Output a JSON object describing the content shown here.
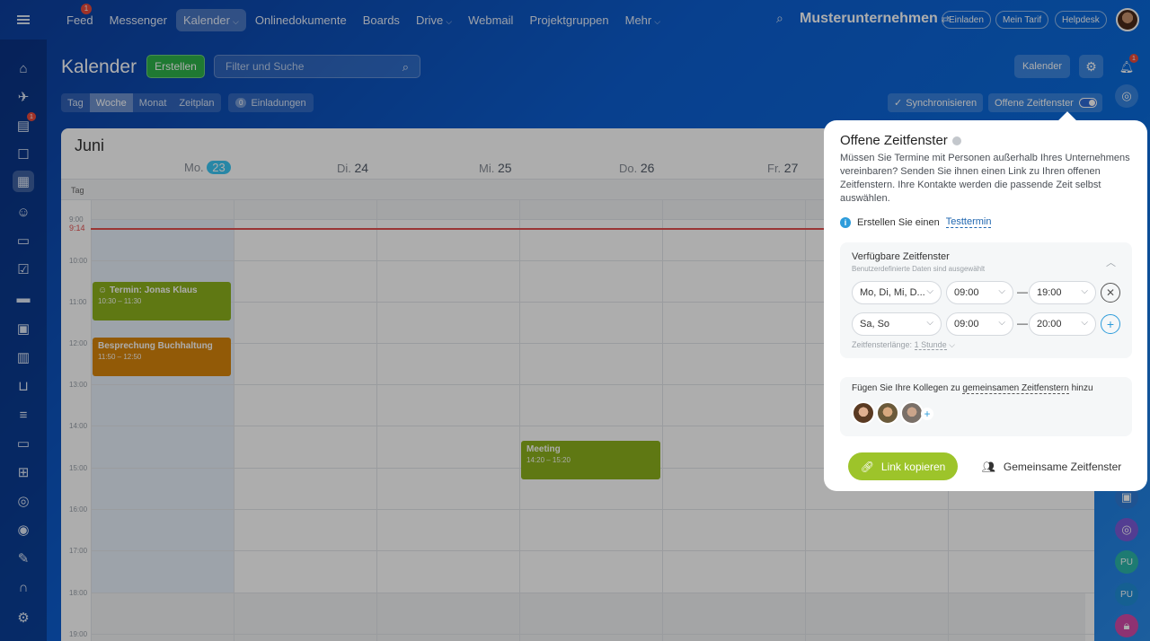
{
  "topbar": {
    "nav": [
      {
        "label": "Feed",
        "badge": "1"
      },
      {
        "label": "Messenger"
      },
      {
        "label": "Kalender",
        "dropdown": true,
        "active": true
      },
      {
        "label": "Onlinedokumente"
      },
      {
        "label": "Boards"
      },
      {
        "label": "Drive",
        "dropdown": true
      },
      {
        "label": "Webmail"
      },
      {
        "label": "Projektgruppen"
      },
      {
        "label": "Mehr",
        "dropdown": true
      }
    ],
    "company": "Musterunternehmen",
    "invite": "Einladen",
    "tariff": "Mein Tarif",
    "helpdesk": "Helpdesk"
  },
  "sidebar": {
    "icons": [
      "home-icon",
      "rocket-icon",
      "tasks-icon",
      "chat-icon",
      "calendar-icon",
      "contacts-icon",
      "document-icon",
      "checklist-icon",
      "drive-icon",
      "board-icon",
      "analytics-icon",
      "cart-icon",
      "filter-icon",
      "monitor-icon",
      "sites-icon",
      "robot-icon",
      "target-icon",
      "sign-icon",
      "headset-icon",
      "settings-icon"
    ],
    "tasks_badge": "1"
  },
  "header": {
    "title": "Kalender",
    "create": "Erstellen",
    "filter_placeholder": "Filter und Suche",
    "calendar_btn": "Kalender"
  },
  "views": [
    "Tag",
    "Woche",
    "Monat",
    "Zeitplan"
  ],
  "active_view": "Woche",
  "invitations": {
    "count": "0",
    "label": "Einladungen"
  },
  "sync": "Synchronisieren",
  "offene_toggle": "Offene Zeitfenster",
  "bell_badge": "1",
  "calendar": {
    "month": "Juni",
    "days": [
      {
        "name": "Mo.",
        "num": "23",
        "today": true
      },
      {
        "name": "Di.",
        "num": "24"
      },
      {
        "name": "Mi.",
        "num": "25"
      },
      {
        "name": "Do.",
        "num": "26"
      },
      {
        "name": "Fr.",
        "num": "27"
      }
    ],
    "allday": "Tag",
    "hours": [
      "9:00",
      "10:00",
      "11:00",
      "12:00",
      "13:00",
      "14:00",
      "15:00",
      "16:00",
      "17:00",
      "18:00",
      "19:00"
    ],
    "now": "9:14",
    "events": [
      {
        "title": "Termin: Jonas Klaus",
        "time": "10:30 – 11:30",
        "color": "#8cb21c"
      },
      {
        "title": "Besprechung Buchhaltung",
        "time": "11:50 – 12:50",
        "color": "#d7850b"
      },
      {
        "title": "Meeting",
        "time": "14:20 – 15:20",
        "color": "#8cb21c"
      }
    ]
  },
  "right_strip": {
    "pu1": "PU",
    "pu2": "PU"
  },
  "popup": {
    "title": "Offene Zeitfenster",
    "description": "Müssen Sie Termine mit Personen außerhalb Ihres Unternehmens vereinbaren? Senden Sie ihnen einen Link zu Ihren offenen Zeitfenstern. Ihre Kontakte werden die passende Zeit selbst auswählen.",
    "info_prefix": "Erstellen Sie einen",
    "info_link": "Testtermin",
    "slots_title": "Verfügbare Zeitfenster",
    "slots_subtitle": "Benutzerdefinierte Daten sind ausgewählt",
    "rows": [
      {
        "days": "Mo, Di, Mi, D...",
        "from": "09:00",
        "to": "19:00",
        "action": "remove"
      },
      {
        "days": "Sa, So",
        "from": "09:00",
        "to": "20:00",
        "action": "add"
      }
    ],
    "length_label": "Zeitfensterlänge:",
    "length_value": "1 Stunde",
    "colleagues_prefix": "Fügen Sie Ihre Kollegen zu",
    "colleagues_link": "gemeinsamen Zeitfenstern",
    "colleagues_suffix": "hinzu",
    "copy_link": "Link kopieren",
    "shared": "Gemeinsame Zeitfenster"
  },
  "colors": {
    "accent_green": "#2fb34a",
    "today": "#3bc8f5",
    "now_line": "#e45050",
    "link_button": "#9dc42a"
  }
}
